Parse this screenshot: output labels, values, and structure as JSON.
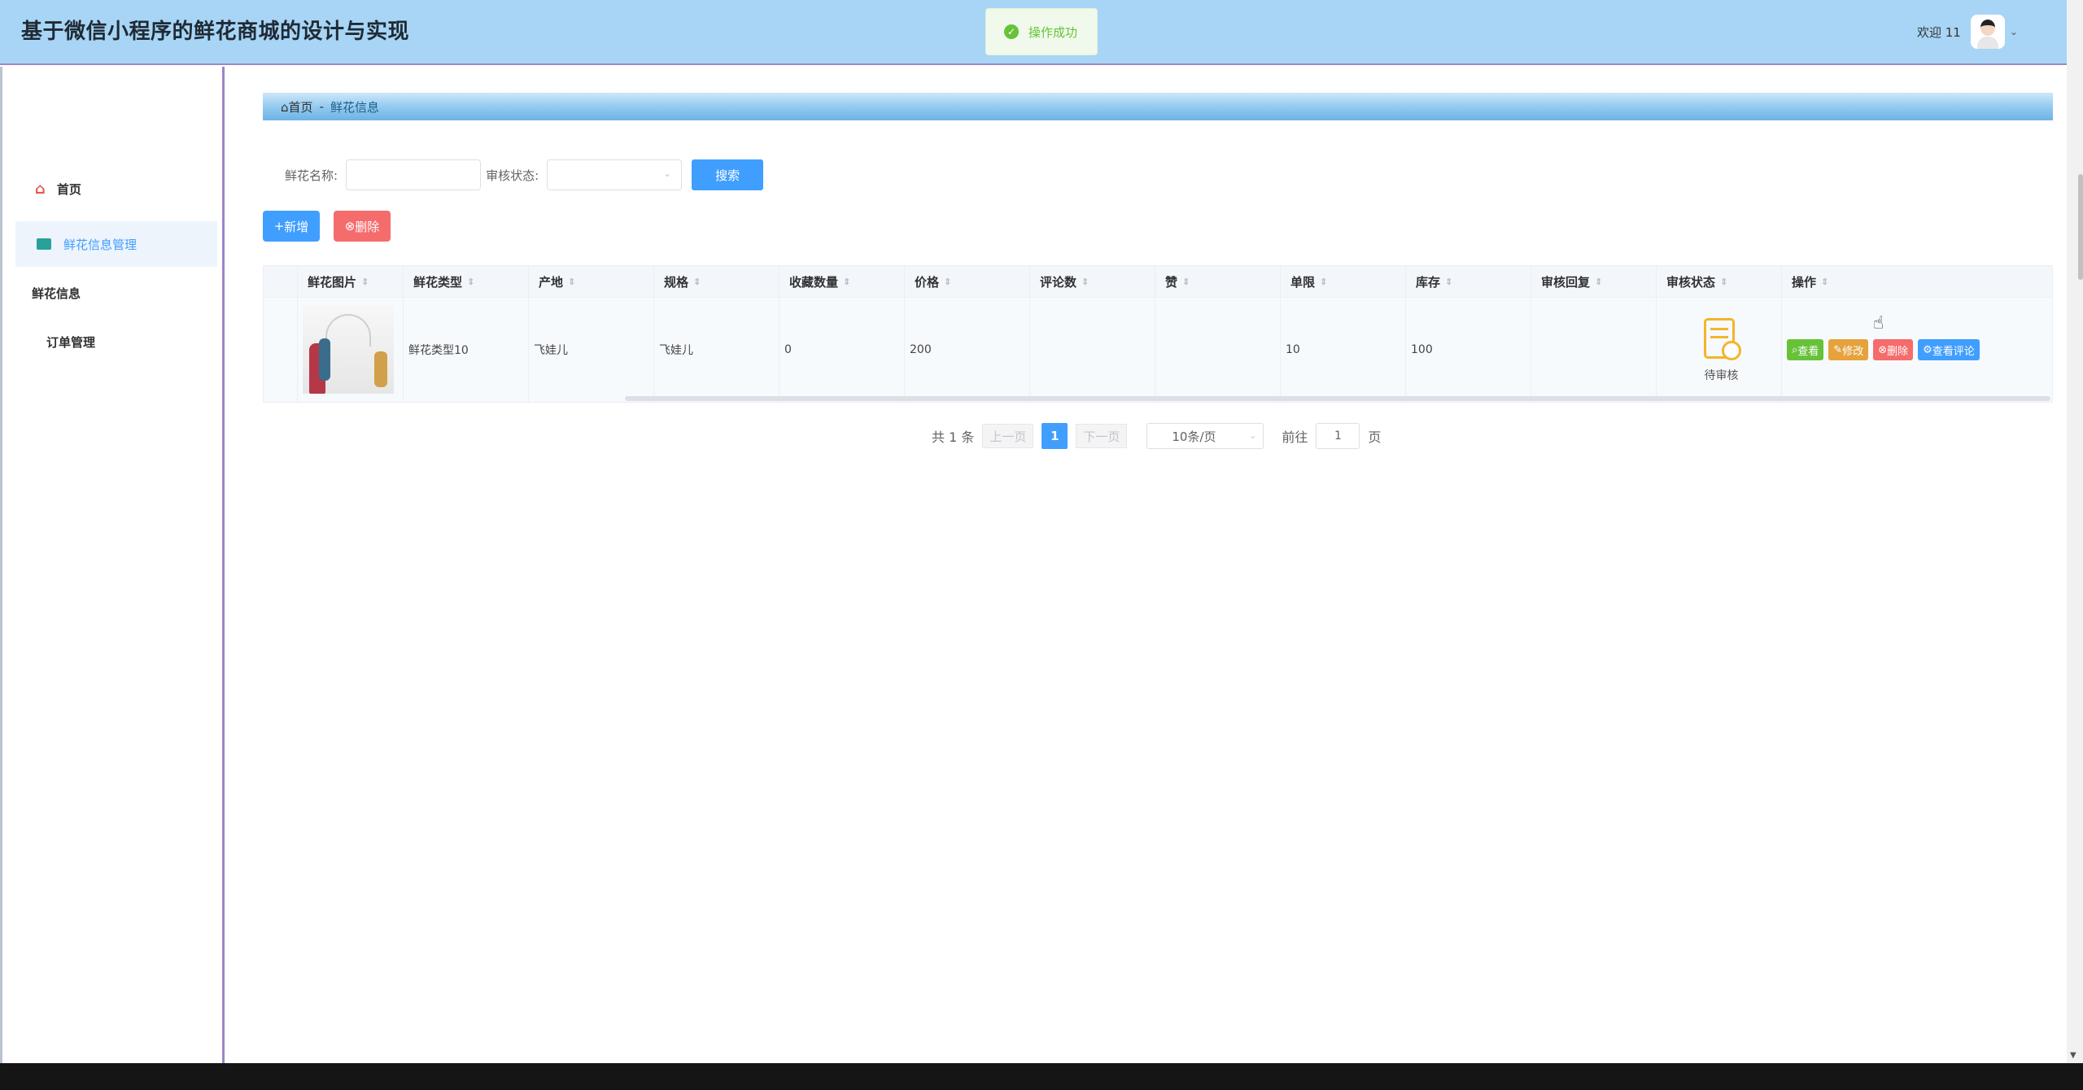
{
  "app": {
    "title": "基于微信小程序的鲜花商城的设计与实现"
  },
  "toast": {
    "text": "操作成功",
    "icon": "check-circle-icon"
  },
  "user": {
    "welcome": "欢迎 11"
  },
  "sidebar": {
    "items": [
      {
        "label": "首页",
        "icon": "home-icon"
      },
      {
        "label": "鲜花信息管理",
        "icon": "table-icon",
        "active": true
      },
      {
        "label": "鲜花信息"
      },
      {
        "label": "订单管理"
      }
    ]
  },
  "breadcrumb": {
    "home": "首页",
    "separator": "-",
    "current": "鲜花信息"
  },
  "search": {
    "name_label": "鲜花名称:",
    "status_label": "审核状态:",
    "button": "搜索"
  },
  "actions": {
    "add": "新增",
    "delete": "删除"
  },
  "table": {
    "headers": [
      "鲜花图片",
      "鲜花类型",
      "产地",
      "规格",
      "收藏数量",
      "价格",
      "评论数",
      "赞",
      "单限",
      "库存",
      "审核回复",
      "审核状态",
      "操作"
    ],
    "rows": [
      {
        "type": "鲜花类型10",
        "origin": "飞娃儿",
        "spec": "飞娃儿",
        "favorites": "0",
        "price": "200",
        "comments": "",
        "likes": "",
        "limit": "10",
        "stock": "100",
        "reply": "",
        "status": "待审核",
        "ops": {
          "view": "查看",
          "edit": "修改",
          "delete": "删除",
          "comments": "查看评论"
        }
      }
    ]
  },
  "pagination": {
    "total": "共 1 条",
    "prev": "上一页",
    "current": "1",
    "next": "下一页",
    "page_size": "10条/页",
    "goto_label": "前往",
    "goto_value": "1",
    "page_unit": "页"
  },
  "colors": {
    "primary": "#409eff",
    "header_bg": "#a8d5f5",
    "success": "#67c23a",
    "warning": "#e6a23c",
    "danger": "#f56c6c",
    "sidebar_border": "#9a86c7"
  }
}
